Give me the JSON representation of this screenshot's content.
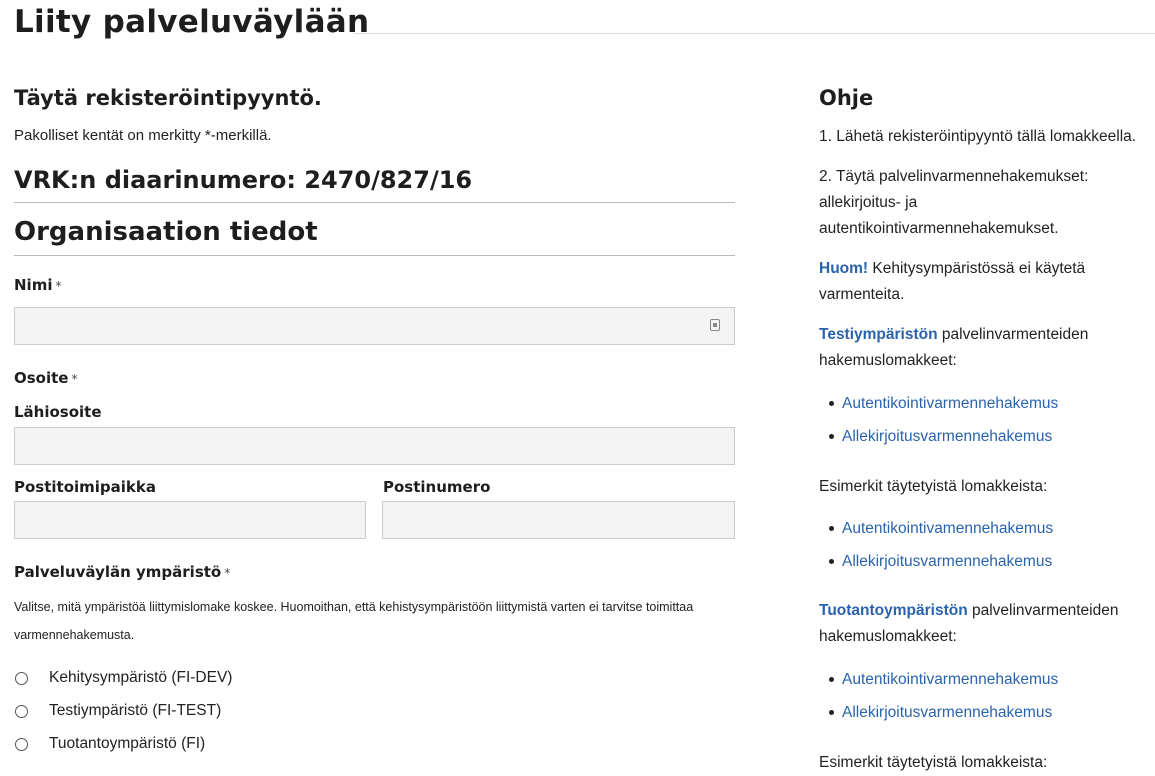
{
  "page": {
    "title": "Liity palveluväylään"
  },
  "form": {
    "heading": "Täytä rekisteröintipyyntö.",
    "required_note": "Pakolliset kentät on merkitty *-merkillä.",
    "diary_number": "VRK:n diaarinumero: 2470/827/16",
    "section_title": "Organisaation tiedot",
    "required_marker": "*",
    "name_label": "Nimi",
    "address_label": "Osoite",
    "street_label": "Lähiosoite",
    "city_label": "Postitoimipaikka",
    "postal_label": "Postinumero",
    "environment_label": "Palveluväylän ympäristö",
    "environment_help": "Valitse, mitä ympäristöä liittymislomake koskee. Huomoithan, että kehistysympäristöön liittymistä varten ei tarvitse toimittaa varmennehakemusta.",
    "environments": [
      {
        "label": "Kehitysympäristö (FI-DEV)",
        "selected": false
      },
      {
        "label": "Testiympäristö (FI-TEST)",
        "selected": false
      },
      {
        "label": "Tuotantoympäristö (FI)",
        "selected": false
      }
    ]
  },
  "sidebar": {
    "title": "Ohje",
    "step1": "1. Lähetä rekisteröintipyyntö tällä lomakkeella.",
    "step2": "2. Täytä palvelinvarmennehakemukset: allekirjoitus- ja autentikointivarmennehakemukset.",
    "note_link": "Huom!",
    "note_text": " Kehitysympäristössä ei käytetä varmenteita.",
    "test_link": "Testiympäristön",
    "test_text": " palvelinvarmenteiden hakemuslomakkeet:",
    "test_links": [
      "Autentikointivarmennehakemus",
      "Allekirjoitusvarmennehakemus"
    ],
    "examples_text": "Esimerkit täytetyistä lomakkeista:",
    "example_links": [
      "Autentikointivamennehakemus",
      "Allekirjoitusvarmennehakemus"
    ],
    "prod_link": "Tuotantoympäristön",
    "prod_text": " palvelinvarmenteiden hakemuslomakkeet:",
    "prod_links": [
      "Autentikointivarmennehakemus",
      "Allekirjoitusvarmennehakemus"
    ],
    "examples_text2": "Esimerkit täytetyistä lomakkeista:"
  },
  "colors": {
    "link": "#2a63ad",
    "input_bg": "#f4f4f4",
    "rule": "#bbbbbb"
  }
}
